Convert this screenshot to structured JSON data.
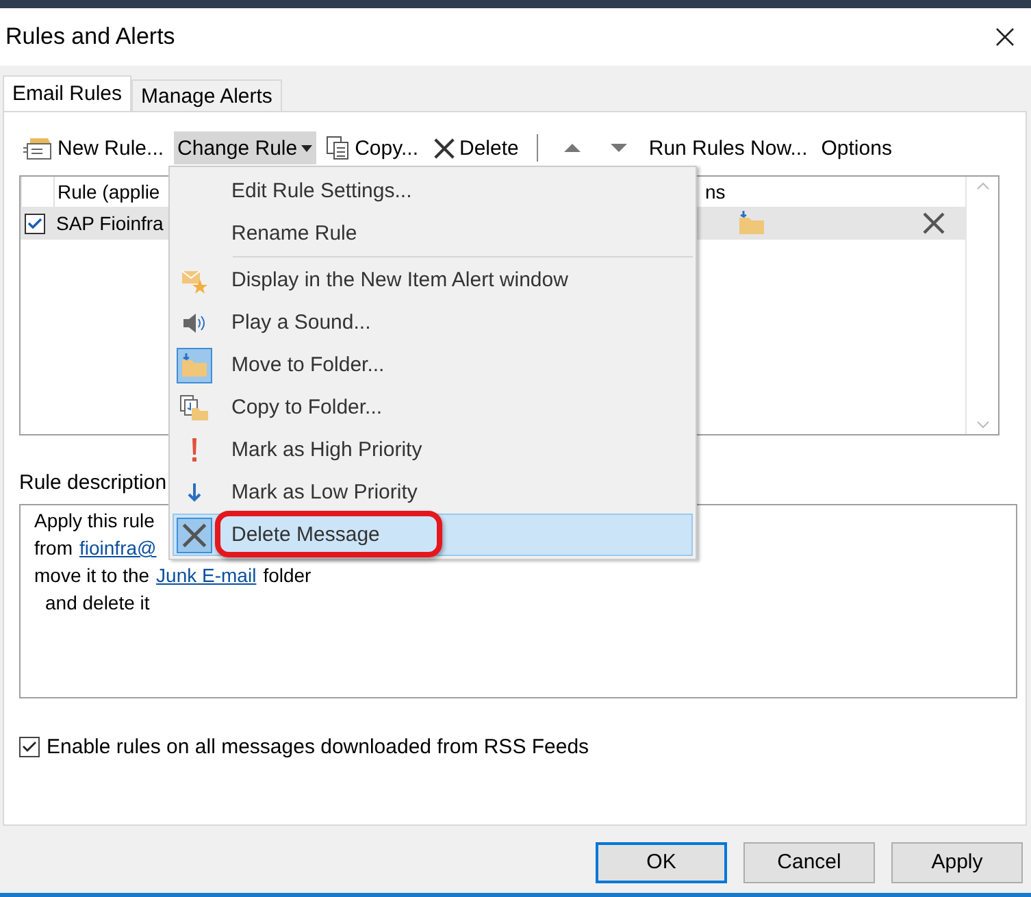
{
  "window": {
    "title": "Rules and Alerts"
  },
  "tabs": [
    {
      "label": "Email Rules",
      "selected": true
    },
    {
      "label": "Manage Alerts",
      "selected": false
    }
  ],
  "toolbar": [
    {
      "kind": "new",
      "label": "New Rule...",
      "open": false
    },
    {
      "kind": "change",
      "label": "Change Rule",
      "open": true
    },
    {
      "kind": "copy",
      "label": "Copy...",
      "open": false
    },
    {
      "kind": "delete",
      "label": "Delete",
      "open": false
    },
    {
      "kind": "separator"
    },
    {
      "kind": "up"
    },
    {
      "kind": "down"
    },
    {
      "kind": "text",
      "label": "Run Rules Now...",
      "open": false
    },
    {
      "kind": "text",
      "label": "Options",
      "open": false
    }
  ],
  "rules_table": {
    "columns": [
      "Rule (applie",
      "ns"
    ],
    "rows": [
      {
        "name": "SAP Fioinfra",
        "checked": true,
        "selected": true
      }
    ]
  },
  "menu": {
    "items": [
      {
        "kind": "none",
        "label": "Edit Rule Settings...",
        "checked": false,
        "selected": false
      },
      {
        "kind": "none",
        "label": "Rename Rule",
        "checked": false,
        "selected": false
      },
      {
        "kind": "separator"
      },
      {
        "kind": "alert",
        "label": "Display in the New Item Alert window",
        "checked": false,
        "selected": false
      },
      {
        "kind": "sound",
        "label": "Play a Sound...",
        "checked": false,
        "selected": false
      },
      {
        "kind": "move",
        "label": "Move to Folder...",
        "checked": true,
        "selected": false
      },
      {
        "kind": "copyfolder",
        "label": "Copy to Folder...",
        "checked": false,
        "selected": false
      },
      {
        "kind": "high",
        "label": "Mark as High Priority",
        "checked": false,
        "selected": false
      },
      {
        "kind": "low",
        "label": "Mark as Low Priority",
        "checked": false,
        "selected": false
      },
      {
        "kind": "deletemsg",
        "label": "Delete Message",
        "checked": true,
        "selected": true,
        "annotated": true
      }
    ]
  },
  "description": {
    "label": "Rule description",
    "lines": [
      [
        {
          "text": "Apply this rule",
          "link": false
        }
      ],
      [
        {
          "text": "from",
          "link": false
        },
        {
          "text": "fioinfra@",
          "link": true
        }
      ],
      [
        {
          "text": "move it to the",
          "link": false
        },
        {
          "text": "Junk E-mail",
          "link": true
        },
        {
          "text": "folder",
          "link": false
        }
      ],
      [
        {
          "text": "and delete it",
          "link": false
        }
      ]
    ]
  },
  "rss_option": {
    "label": "Enable rules on all messages downloaded from RSS Feeds",
    "checked": true
  },
  "buttons": [
    {
      "label": "OK",
      "default": true
    },
    {
      "label": "Cancel",
      "default": false
    },
    {
      "label": "Apply",
      "default": false
    }
  ]
}
